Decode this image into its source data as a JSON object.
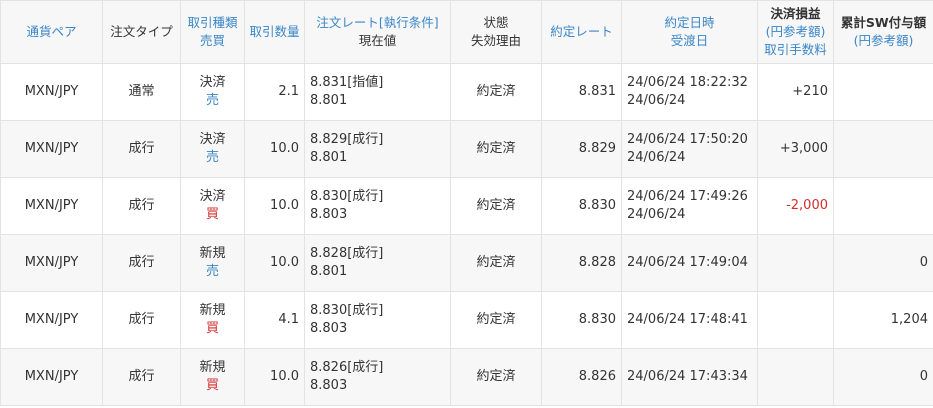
{
  "headers": {
    "pair": "通貨ペア",
    "order_type": "注文タイプ",
    "trade_type_l1": "取引種類",
    "trade_type_l2": "売買",
    "quantity": "取引数量",
    "order_rate_l1": "注文レート[執行条件]",
    "order_rate_l2": "現在値",
    "status_l1": "状態",
    "status_l2": "失効理由",
    "exec_rate": "約定レート",
    "exec_datetime_l1": "約定日時",
    "exec_datetime_l2": "受渡日",
    "pnl_l1": "決済損益",
    "pnl_l2": "(円参考額)",
    "pnl_l3": "取引手数料",
    "swap_l1": "累計SW付与額",
    "swap_l2": "(円参考額)"
  },
  "rows": [
    {
      "pair": "MXN/JPY",
      "order_type": "通常",
      "trade_kind": "決済",
      "side": "売",
      "side_type": "sell",
      "quantity": "2.1",
      "order_rate": "8.831[指値]",
      "current": "8.801",
      "status": "約定済",
      "exec_rate": "8.831",
      "exec_datetime": "24/06/24 18:22:32",
      "settle_date": "24/06/24",
      "pnl": "+210",
      "pnl_type": "pos",
      "swap": ""
    },
    {
      "pair": "MXN/JPY",
      "order_type": "成行",
      "trade_kind": "決済",
      "side": "売",
      "side_type": "sell",
      "quantity": "10.0",
      "order_rate": "8.829[成行]",
      "current": "8.801",
      "status": "約定済",
      "exec_rate": "8.829",
      "exec_datetime": "24/06/24 17:50:20",
      "settle_date": "24/06/24",
      "pnl": "+3,000",
      "pnl_type": "pos",
      "swap": ""
    },
    {
      "pair": "MXN/JPY",
      "order_type": "成行",
      "trade_kind": "決済",
      "side": "買",
      "side_type": "buy",
      "quantity": "10.0",
      "order_rate": "8.830[成行]",
      "current": "8.803",
      "status": "約定済",
      "exec_rate": "8.830",
      "exec_datetime": "24/06/24 17:49:26",
      "settle_date": "24/06/24",
      "pnl": "-2,000",
      "pnl_type": "neg",
      "swap": ""
    },
    {
      "pair": "MXN/JPY",
      "order_type": "成行",
      "trade_kind": "新規",
      "side": "売",
      "side_type": "sell",
      "quantity": "10.0",
      "order_rate": "8.828[成行]",
      "current": "8.801",
      "status": "約定済",
      "exec_rate": "8.828",
      "exec_datetime": "24/06/24 17:49:04",
      "settle_date": "",
      "pnl": "",
      "pnl_type": "pos",
      "swap": "0"
    },
    {
      "pair": "MXN/JPY",
      "order_type": "成行",
      "trade_kind": "新規",
      "side": "買",
      "side_type": "buy",
      "quantity": "4.1",
      "order_rate": "8.830[成行]",
      "current": "8.803",
      "status": "約定済",
      "exec_rate": "8.830",
      "exec_datetime": "24/06/24 17:48:41",
      "settle_date": "",
      "pnl": "",
      "pnl_type": "pos",
      "swap": "1,204"
    },
    {
      "pair": "MXN/JPY",
      "order_type": "成行",
      "trade_kind": "新規",
      "side": "買",
      "side_type": "buy",
      "quantity": "10.0",
      "order_rate": "8.826[成行]",
      "current": "8.803",
      "status": "約定済",
      "exec_rate": "8.826",
      "exec_datetime": "24/06/24 17:43:34",
      "settle_date": "",
      "pnl": "",
      "pnl_type": "pos",
      "swap": "0"
    }
  ]
}
